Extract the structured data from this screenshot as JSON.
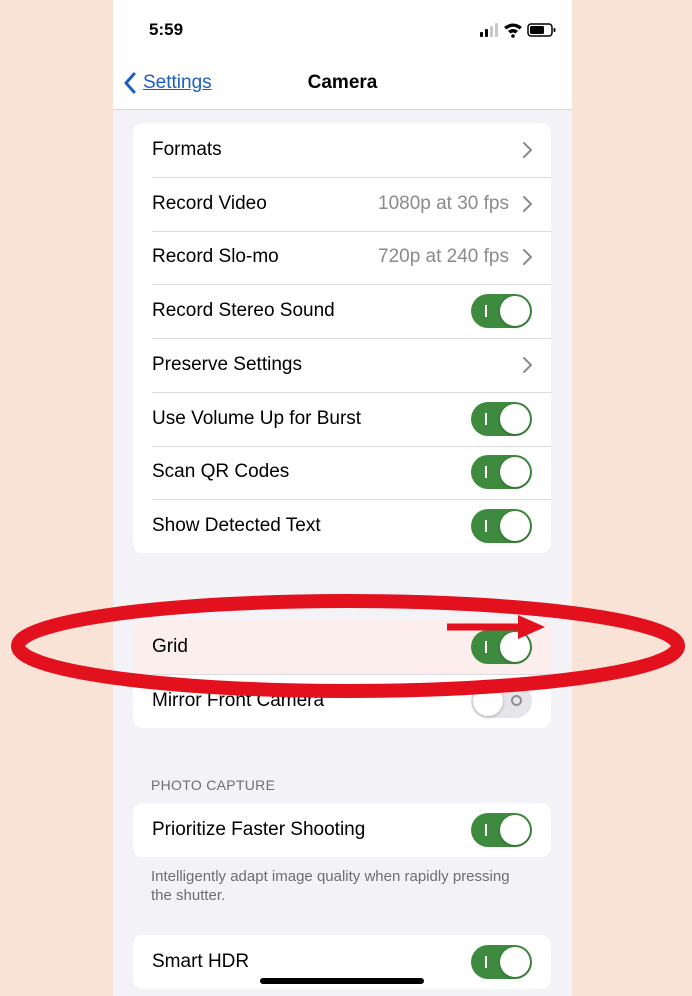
{
  "status_bar": {
    "time": "5:59"
  },
  "nav": {
    "back_label": "Settings",
    "title": "Camera"
  },
  "group1": {
    "formats": {
      "label": "Formats"
    },
    "record_video": {
      "label": "Record Video",
      "value": "1080p at 30 fps"
    },
    "record_slomo": {
      "label": "Record Slo-mo",
      "value": "720p at 240 fps"
    },
    "record_stereo": {
      "label": "Record Stereo Sound",
      "on": true
    },
    "preserve": {
      "label": "Preserve Settings"
    },
    "volume_burst": {
      "label": "Use Volume Up for Burst",
      "on": true
    },
    "scan_qr": {
      "label": "Scan QR Codes",
      "on": true
    },
    "detected_text": {
      "label": "Show Detected Text",
      "on": true
    }
  },
  "composition": {
    "grid": {
      "label": "Grid",
      "on": true
    },
    "mirror": {
      "label": "Mirror Front Camera",
      "on": false
    }
  },
  "photo_capture": {
    "header": "PHOTO CAPTURE",
    "prioritize": {
      "label": "Prioritize Faster Shooting",
      "on": true
    },
    "footnote": "Intelligently adapt image quality when rapidly pressing the shutter."
  },
  "hdr": {
    "smart_hdr": {
      "label": "Smart HDR",
      "on": true
    }
  },
  "colors": {
    "accent": "#1a5fc7",
    "toggle_on": "#3e8a3e",
    "annotation": "#e3101d",
    "background": "#f9e3d6"
  },
  "icons": [
    "chevron-left-icon",
    "chevron-right-icon",
    "signal-icon",
    "wifi-icon",
    "battery-icon",
    "annotation-ellipse",
    "annotation-arrow"
  ]
}
